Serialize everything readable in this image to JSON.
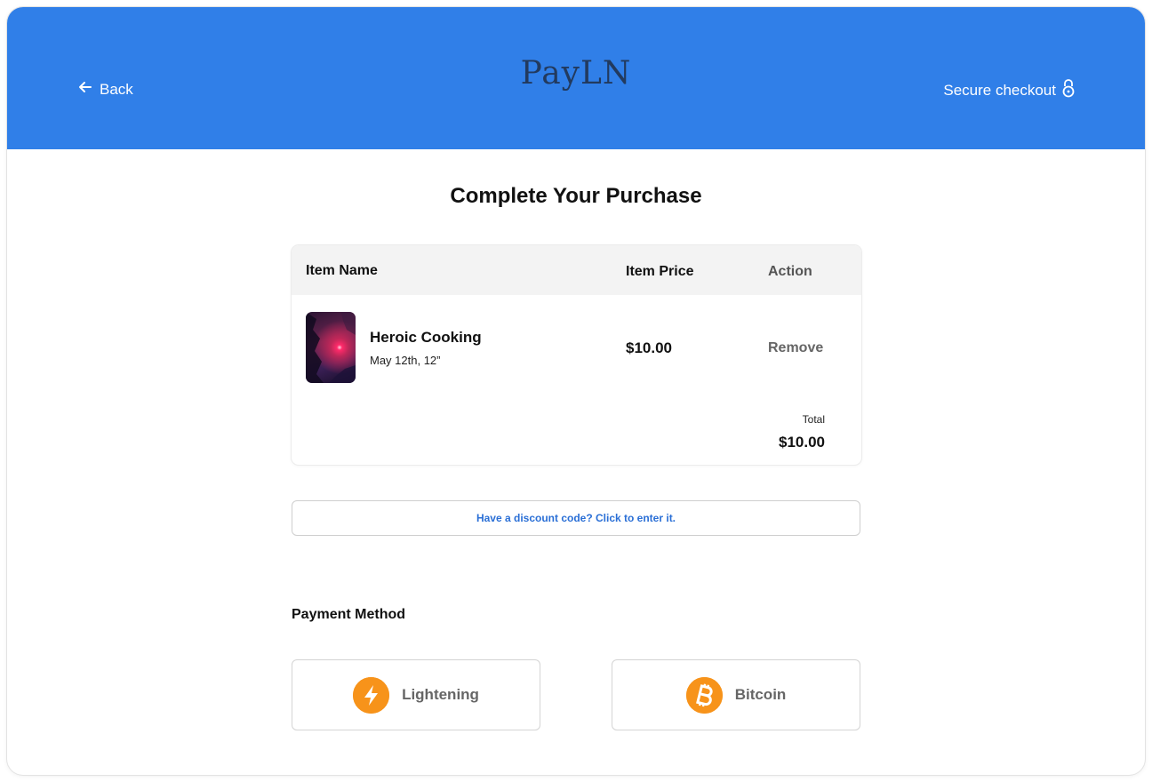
{
  "header": {
    "back_label": "Back",
    "brand": "PayLN",
    "secure_label": "Secure checkout",
    "background_color": "#307fe8"
  },
  "page": {
    "title": "Complete Your Purchase"
  },
  "cart": {
    "columns": {
      "name": "Item Name",
      "price": "Item Price",
      "action": "Action"
    },
    "items": [
      {
        "title": "Heroic Cooking",
        "subtitle": "May 12th, 12”",
        "price": "$10.00",
        "action": "Remove"
      }
    ],
    "total_label": "Total",
    "total_value": "$10.00"
  },
  "discount": {
    "label": "Have a discount code? Click to enter it."
  },
  "payment": {
    "title": "Payment Method",
    "options": [
      {
        "label": "Lightening",
        "icon": "lightning-icon",
        "color": "#f7931a"
      },
      {
        "label": "Bitcoin",
        "icon": "bitcoin-icon",
        "color": "#f7931a"
      }
    ]
  }
}
